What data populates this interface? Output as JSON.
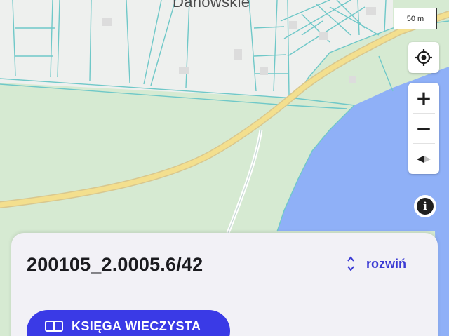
{
  "map": {
    "place_label": "Danowskie",
    "scale_label": "50 m",
    "colors": {
      "land": "#d6ead2",
      "built_area": "#eef0ee",
      "water": "#8fb0f7",
      "road": "#f3df8e",
      "parcel_lines": "#6fc8c8"
    }
  },
  "controls": {
    "locate_icon": "crosshair-locate-icon",
    "zoom_in": "+",
    "zoom_out": "−",
    "compass_icon": "compass-icon",
    "info_icon": "info-icon",
    "info_glyph": "i"
  },
  "sheet": {
    "parcel_id": "200105_2.0005.6/42",
    "expand_label": "rozwiń",
    "expand_icon": "unfold-chevrons-icon",
    "kw_button_label": "KSIĘGA WIECZYSTA",
    "kw_button_icon": "book-icon",
    "accent": "#3a3ae6"
  }
}
